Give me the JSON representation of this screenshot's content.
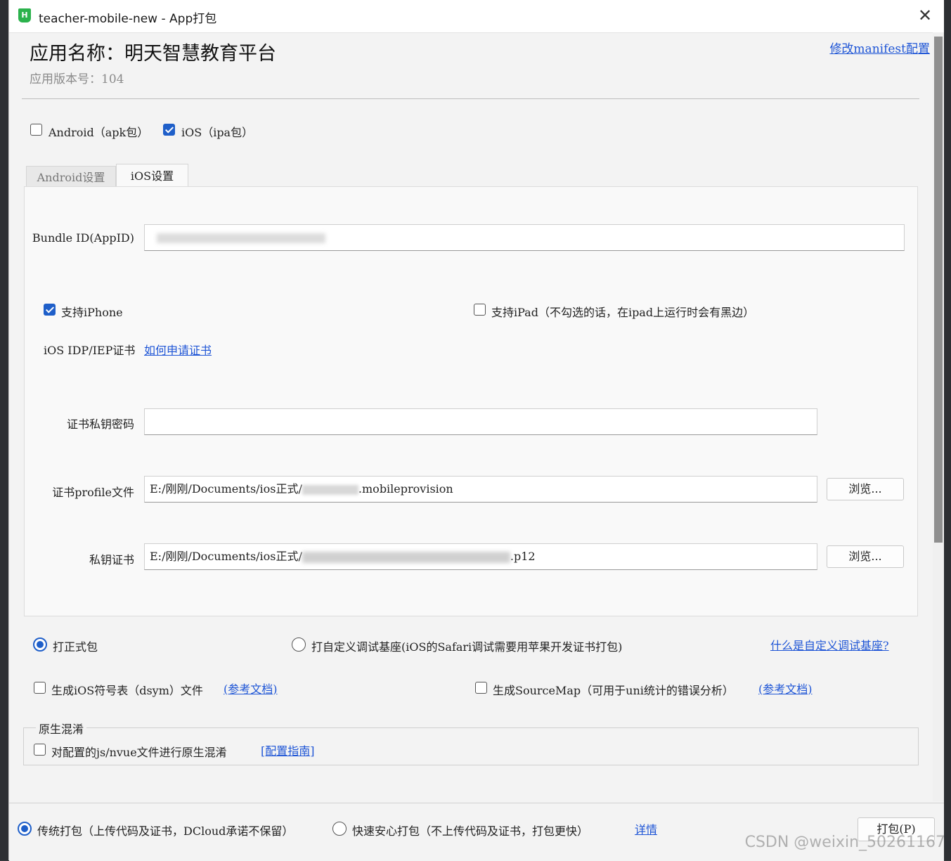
{
  "window": {
    "title": "teacher-mobile-new - App打包",
    "icon_letter": "H"
  },
  "header": {
    "app_name": "应用名称：明天智慧教育平台",
    "app_version": "应用版本号：104",
    "manifest_link": "修改manifest配置"
  },
  "platforms": {
    "android_label": "Android（apk包）",
    "android_checked": false,
    "ios_label": "iOS（ipa包）",
    "ios_checked": true
  },
  "tabs": [
    {
      "label": "Android设置",
      "active": false
    },
    {
      "label": "iOS设置",
      "active": true
    }
  ],
  "ios_settings": {
    "bundle_id_label": "Bundle ID(AppID)",
    "bundle_id_value": "",
    "support_iphone_label": "支持iPhone",
    "support_iphone_checked": true,
    "support_ipad_label": "支持iPad（不勾选的话，在ipad上运行时会有黑边）",
    "support_ipad_checked": false,
    "cert_label": "iOS IDP/IEP证书",
    "cert_help_link": "如何申请证书",
    "private_key_password_label": "证书私钥密码",
    "private_key_password_value": "",
    "profile_label": "证书profile文件",
    "profile_value_prefix": "E:/刚刚/Documents/ios正式/",
    "profile_value_suffix": ".mobileprovision",
    "browse_label": "浏览...",
    "private_cert_label": "私钥证书",
    "private_cert_value_prefix": "E:/刚刚/Documents/ios正式/",
    "private_cert_value_suffix": ".p12"
  },
  "build_type": {
    "release_label": "打正式包",
    "release_selected": true,
    "custom_base_label": "打自定义调试基座(iOS的Safari调试需要用苹果开发证书打包)",
    "custom_base_selected": false,
    "custom_base_link": "什么是自定义调试基座?"
  },
  "options": {
    "dsym_label": "生成iOS符号表（dsym）文件",
    "dsym_checked": false,
    "dsym_link": "(参考文档)",
    "sourcemap_label": "生成SourceMap（可用于uni统计的错误分析）",
    "sourcemap_checked": false,
    "sourcemap_link": "(参考文档)"
  },
  "obfuscation": {
    "group_title": "原生混淆",
    "label": "对配置的js/nvue文件进行原生混淆",
    "checked": false,
    "guide_link": "[配置指南]"
  },
  "footer": {
    "traditional_label": "传统打包（上传代码及证书，DCloud承诺不保留）",
    "traditional_selected": true,
    "fast_label": "快速安心打包（不上传代码及证书，打包更快）",
    "fast_selected": false,
    "details_link": "详情",
    "pack_button": "打包(P)"
  },
  "watermark": "CSDN @weixin_50261167",
  "colors": {
    "accent": "#1f5fc9",
    "link": "#1e55d6",
    "window_bg": "#f3f3f3"
  }
}
